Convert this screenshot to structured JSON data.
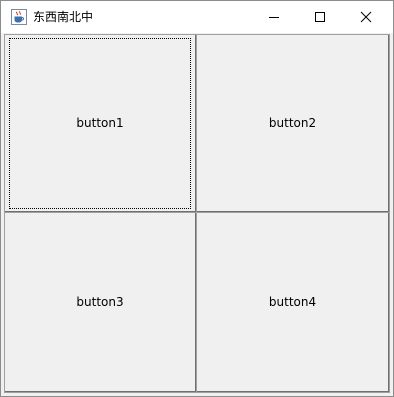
{
  "window": {
    "title": "东西南北中",
    "icon": "java-cup-icon"
  },
  "caption_buttons": {
    "minimize_icon": "minimize-icon",
    "maximize_icon": "maximize-icon",
    "close_icon": "close-icon"
  },
  "buttons": [
    {
      "label": "button1",
      "focused": true
    },
    {
      "label": "button2",
      "focused": false
    },
    {
      "label": "button3",
      "focused": false
    },
    {
      "label": "button4",
      "focused": false
    }
  ],
  "colors": {
    "panel_bg": "#f0f0f0",
    "titlebar_bg": "#ffffff"
  }
}
